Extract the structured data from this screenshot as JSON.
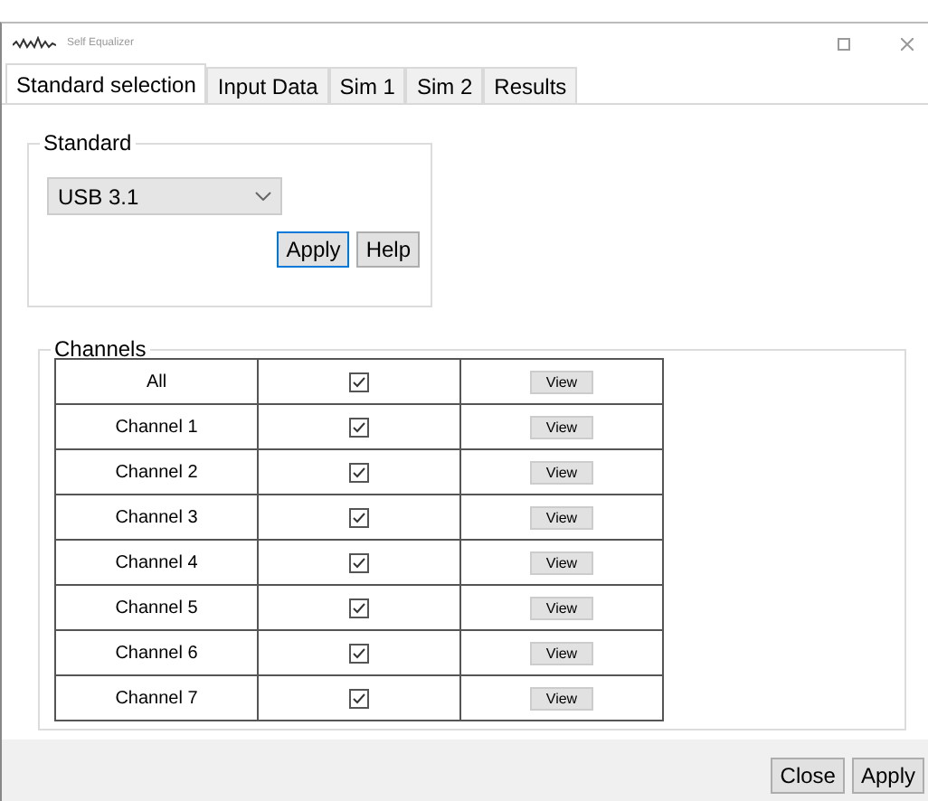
{
  "window": {
    "title": "Self Equalizer"
  },
  "tabs": [
    {
      "label": "Standard selection",
      "selected": true
    },
    {
      "label": "Input Data",
      "selected": false
    },
    {
      "label": "Sim 1",
      "selected": false
    },
    {
      "label": "Sim 2",
      "selected": false
    },
    {
      "label": "Results",
      "selected": false
    }
  ],
  "standard": {
    "legend": "Standard",
    "value": "USB 3.1",
    "buttons": [
      {
        "label": "Apply",
        "focused": true
      },
      {
        "label": "Help",
        "focused": false
      }
    ]
  },
  "channels": {
    "legend": "Channels",
    "rows": [
      {
        "name": "All",
        "checked": true,
        "button": "View"
      },
      {
        "name": "Channel 1",
        "checked": true,
        "button": "View"
      },
      {
        "name": "Channel 2",
        "checked": true,
        "button": "View"
      },
      {
        "name": "Channel 3",
        "checked": true,
        "button": "View"
      },
      {
        "name": "Channel 4",
        "checked": true,
        "button": "View"
      },
      {
        "name": "Channel 5",
        "checked": true,
        "button": "View"
      },
      {
        "name": "Channel 6",
        "checked": true,
        "button": "View"
      },
      {
        "name": "Channel 7",
        "checked": true,
        "button": "View"
      }
    ]
  },
  "footer_buttons": [
    "Close",
    "Apply"
  ]
}
